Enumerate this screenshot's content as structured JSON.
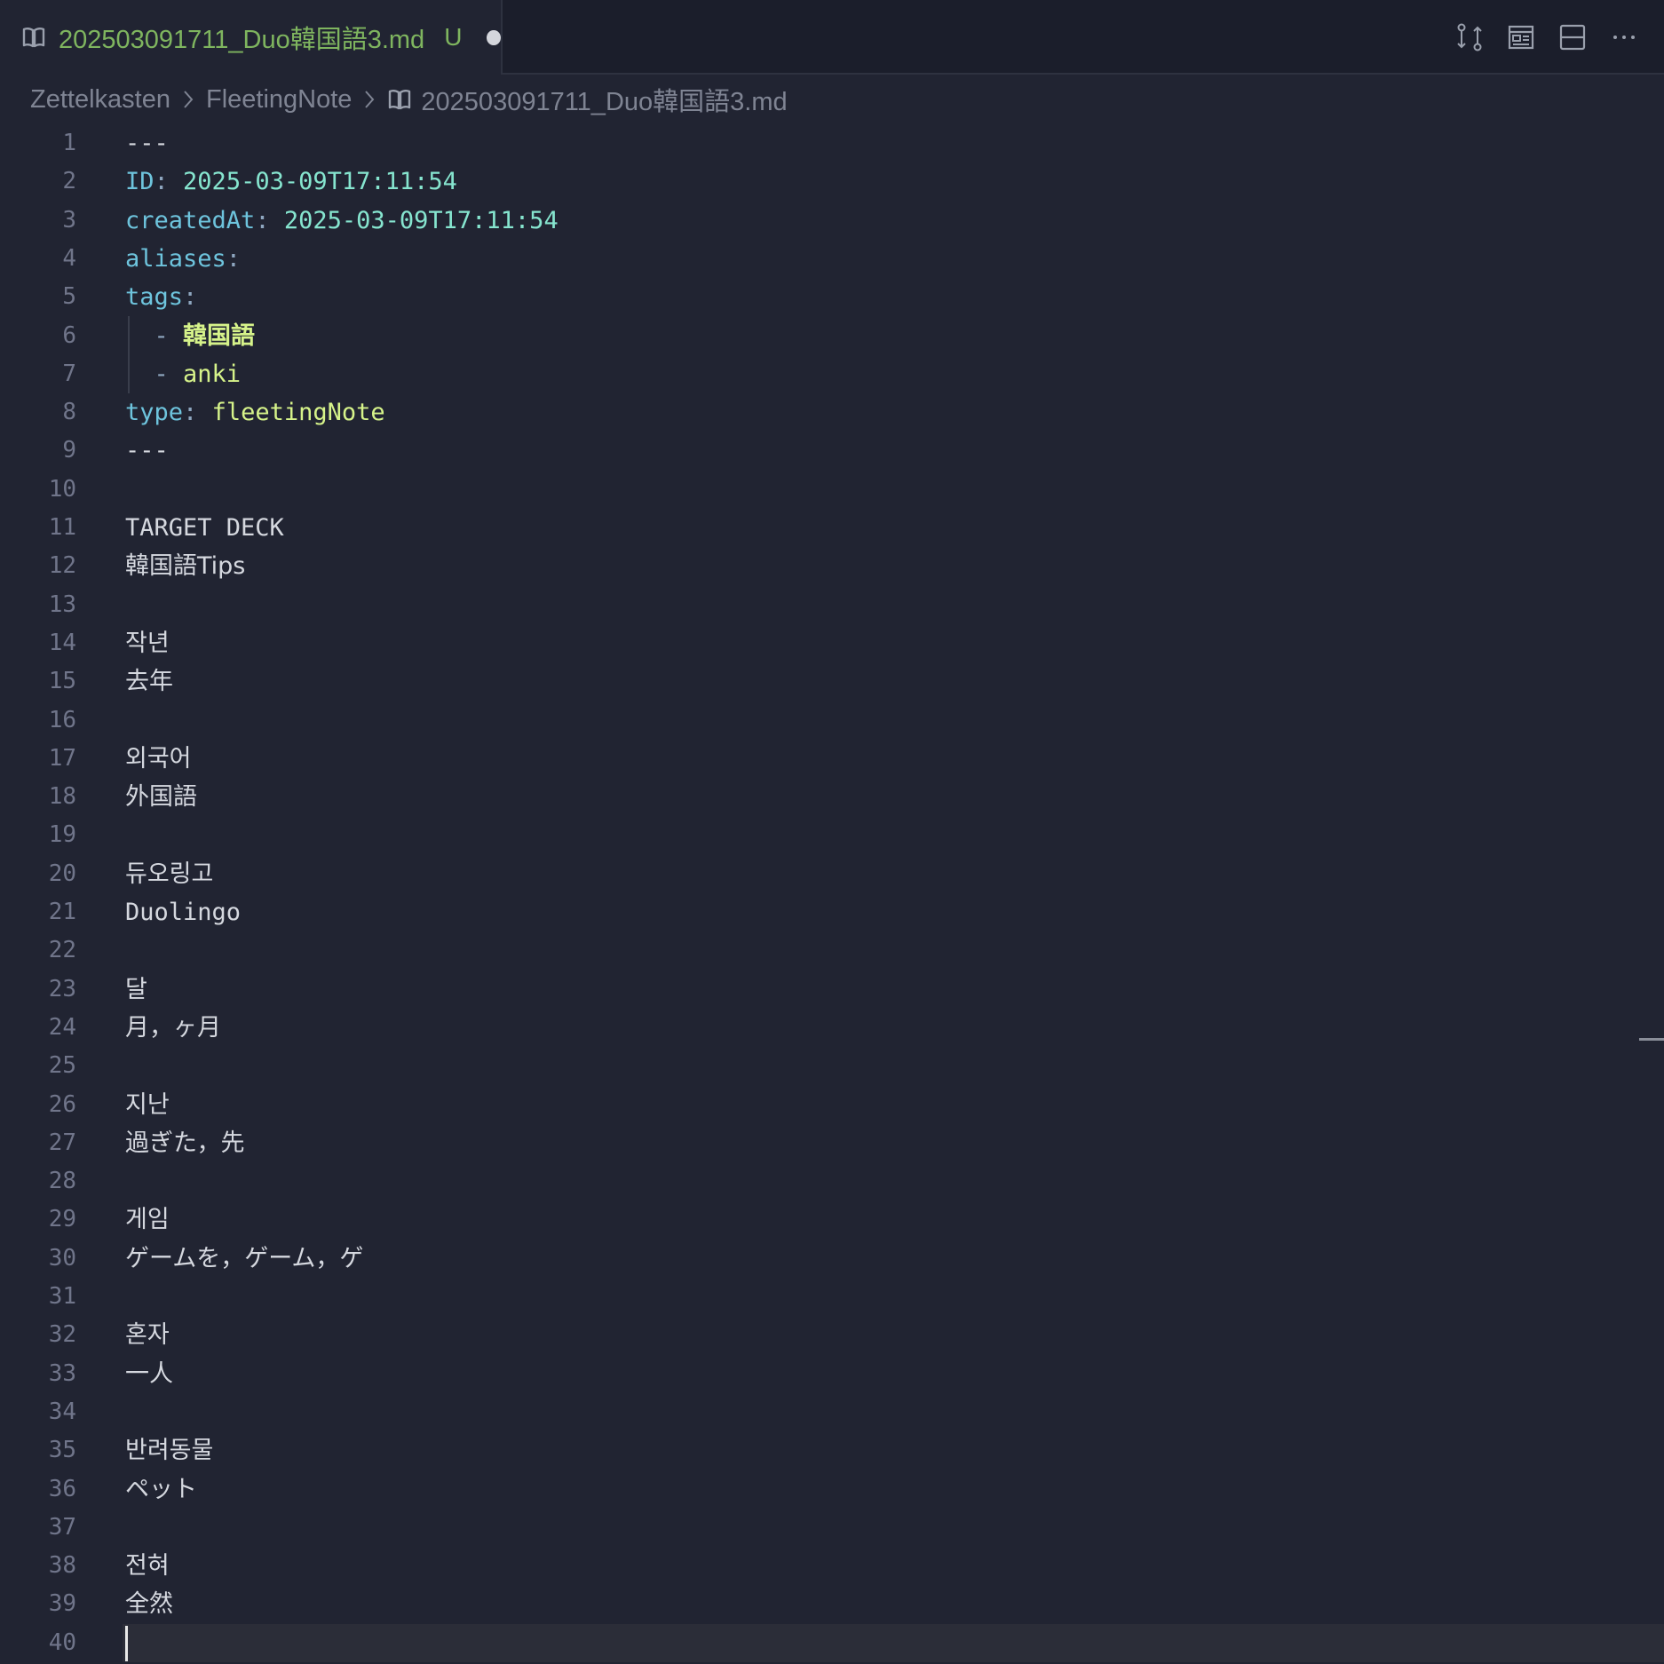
{
  "tab": {
    "filename": "202503091711_Duo韓国語3.md",
    "status": "U",
    "icon": "book-icon"
  },
  "actions": {
    "icons": [
      "compare-changes-icon",
      "open-preview-icon",
      "split-editor-icon",
      "more-actions-icon"
    ],
    "more_label": "···"
  },
  "breadcrumb": {
    "items": [
      "Zettelkasten",
      "FleetingNote",
      "202503091711_Duo韓国語3.md"
    ]
  },
  "colors": {
    "background": "#212432",
    "key": "#6ec4dd",
    "value": "#86e5cf",
    "string": "#d6f38a",
    "tab_label": "#7fb55f"
  },
  "editor": {
    "current_line": 40,
    "lines": [
      {
        "n": "1",
        "t": "---"
      },
      {
        "n": "2",
        "key": "ID",
        "val": "2025-03-09T17:11:54"
      },
      {
        "n": "3",
        "key": "createdAt",
        "val": "2025-03-09T17:11:54"
      },
      {
        "n": "4",
        "key": "aliases"
      },
      {
        "n": "5",
        "key": "tags"
      },
      {
        "n": "6",
        "dash": "- ",
        "str": "韓国語"
      },
      {
        "n": "7",
        "dash": "- ",
        "str": "anki"
      },
      {
        "n": "8",
        "key": "type",
        "str": "fleetingNote"
      },
      {
        "n": "9",
        "t": "---"
      },
      {
        "n": "10",
        "t": ""
      },
      {
        "n": "11",
        "t": "TARGET DECK"
      },
      {
        "n": "12",
        "t": "韓国語Tips"
      },
      {
        "n": "13",
        "t": ""
      },
      {
        "n": "14",
        "t": "작년"
      },
      {
        "n": "15",
        "t": "去年"
      },
      {
        "n": "16",
        "t": ""
      },
      {
        "n": "17",
        "t": "외국어"
      },
      {
        "n": "18",
        "t": "外国語"
      },
      {
        "n": "19",
        "t": ""
      },
      {
        "n": "20",
        "t": "듀오링고"
      },
      {
        "n": "21",
        "t": "Duolingo"
      },
      {
        "n": "22",
        "t": ""
      },
      {
        "n": "23",
        "t": "달"
      },
      {
        "n": "24",
        "t": "月，ヶ月"
      },
      {
        "n": "25",
        "t": ""
      },
      {
        "n": "26",
        "t": "지난"
      },
      {
        "n": "27",
        "t": "過ぎた，先"
      },
      {
        "n": "28",
        "t": ""
      },
      {
        "n": "29",
        "t": "게임"
      },
      {
        "n": "30",
        "t": "ゲームを，ゲーム，ゲ"
      },
      {
        "n": "31",
        "t": ""
      },
      {
        "n": "32",
        "t": "혼자"
      },
      {
        "n": "33",
        "t": "一人"
      },
      {
        "n": "34",
        "t": ""
      },
      {
        "n": "35",
        "t": "반려동물"
      },
      {
        "n": "36",
        "t": "ペット"
      },
      {
        "n": "37",
        "t": ""
      },
      {
        "n": "38",
        "t": "전혀"
      },
      {
        "n": "39",
        "t": "全然"
      },
      {
        "n": "40",
        "t": ""
      }
    ]
  }
}
